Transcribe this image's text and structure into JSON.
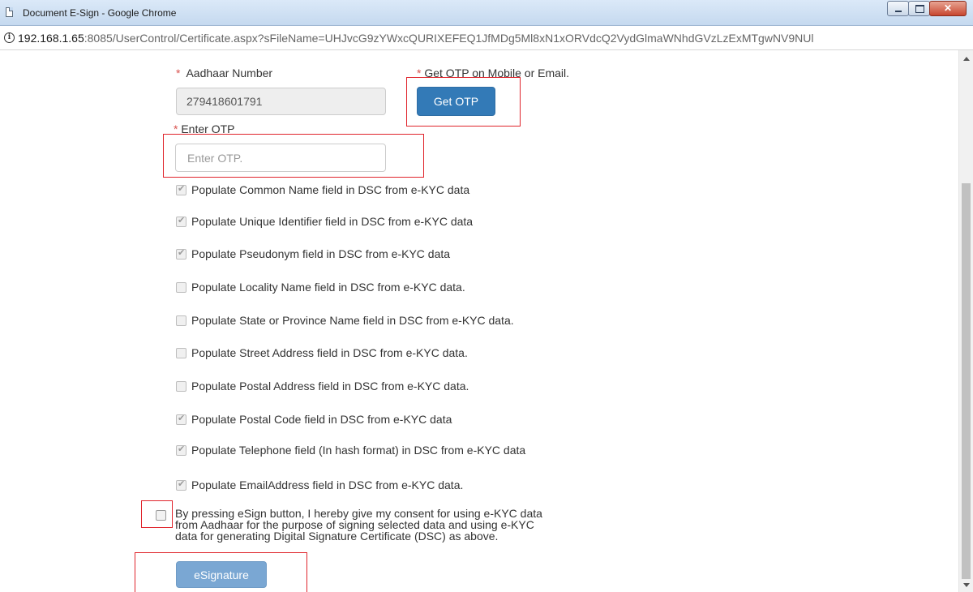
{
  "window": {
    "title": "Document E-Sign - Google Chrome"
  },
  "address_bar": {
    "host": "192.168.1.65",
    "rest": ":8085/UserControl/Certificate.aspx?sFileName=UHJvcG9zYWxcQURIXEFEQ1JfMDg5Ml8xN1xORVdcQ2VydGlmaWNhdGVzLzExMTgwNV9NUl"
  },
  "form": {
    "aadhaar_label": "Aadhaar Number",
    "aadhaar_value": "279418601791",
    "otp_prompt_label": "Get OTP on Mobile or Email.",
    "get_otp_button": "Get OTP",
    "enter_otp_label": "Enter OTP",
    "enter_otp_placeholder": "Enter OTP.",
    "required_marker": "*"
  },
  "checkboxes": [
    {
      "label": "Populate Common Name field in DSC from e-KYC data",
      "checked": true
    },
    {
      "label": "Populate Unique Identifier field in DSC from e-KYC data",
      "checked": true
    },
    {
      "label": "Populate Pseudonym field in DSC from e-KYC data",
      "checked": true
    },
    {
      "label": "Populate Locality Name field in DSC from e-KYC data.",
      "checked": false
    },
    {
      "label": "Populate State or Province Name field in DSC from e-KYC data.",
      "checked": false
    },
    {
      "label": "Populate Street Address field in DSC from e-KYC data.",
      "checked": false
    },
    {
      "label": "Populate Postal Address field in DSC from e-KYC data.",
      "checked": false
    },
    {
      "label": "Populate Postal Code field in DSC from e-KYC data",
      "checked": true
    },
    {
      "label": "Populate Telephone field (In hash format) in DSC from e-KYC data",
      "checked": true
    },
    {
      "label": "Populate EmailAddress field in DSC from e-KYC data.",
      "checked": true
    }
  ],
  "consent": {
    "line1": "By pressing eSign button, I hereby give my consent for using e-KYC data",
    "line2": "from Aadhaar for the purpose of signing selected data and using e-KYC",
    "line3": "data for generating Digital Signature Certificate (DSC) as above.",
    "checked": false
  },
  "esign_button": "eSignature",
  "colors": {
    "primary": "#337ab7",
    "disabled_primary": "#7aa7d3",
    "required": "#d9534f",
    "highlight_box": "#e0242b"
  }
}
